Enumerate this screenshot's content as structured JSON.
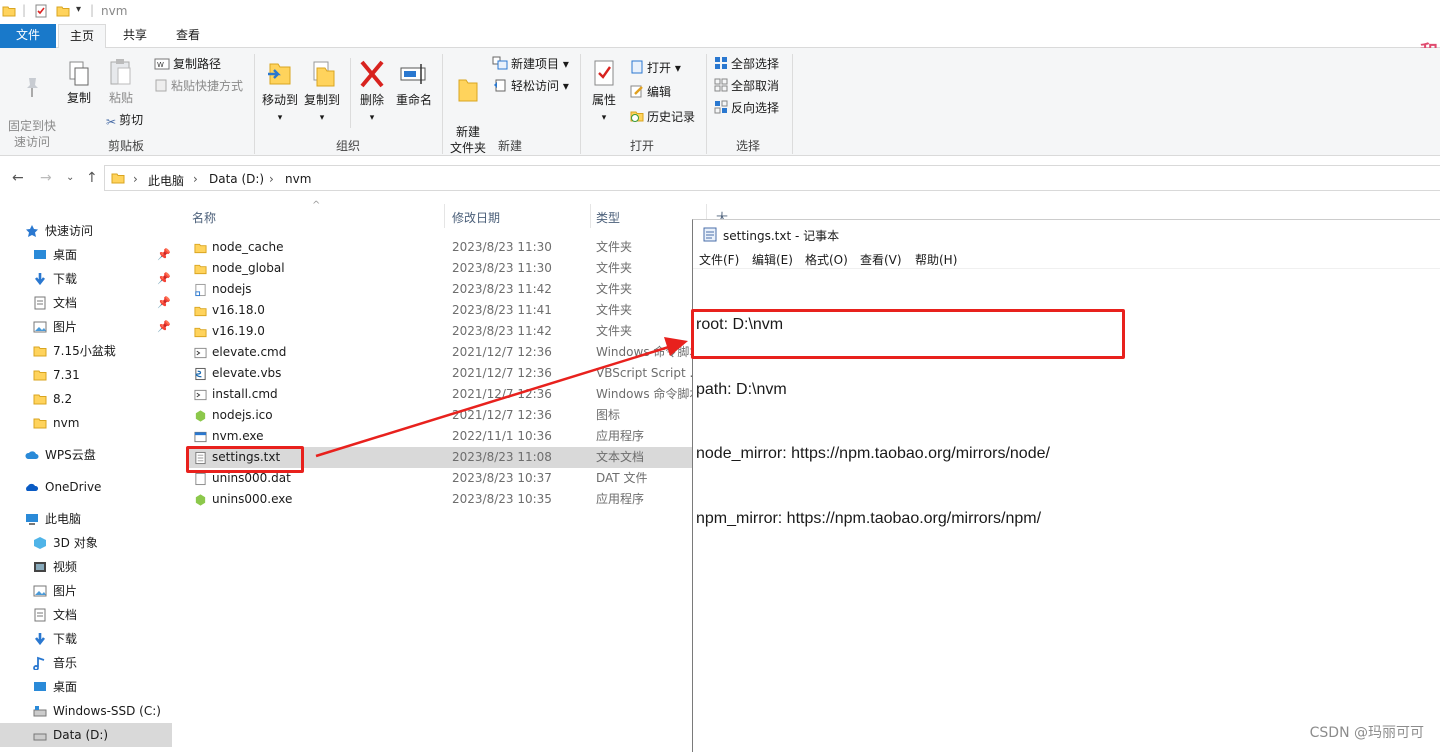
{
  "window": {
    "title": "nvm"
  },
  "tabs": [
    "文件",
    "主页",
    "共享",
    "查看"
  ],
  "ribbon": {
    "clipboard": {
      "pin": "固定到快\n速访问",
      "copy": "复制",
      "paste": "粘贴",
      "copy_path": "复制路径",
      "paste_shortcut": "粘贴快捷方式",
      "cut": "剪切",
      "label": "剪贴板"
    },
    "organize": {
      "move_to": "移动到",
      "copy_to": "复制到",
      "delete": "删除",
      "rename": "重命名",
      "label": "组织"
    },
    "new": {
      "new_folder": "新建\n文件夹",
      "new_item": "新建项目 ▾",
      "easy_access": "轻松访问 ▾",
      "label": "新建"
    },
    "open": {
      "properties": "属性",
      "open": "打开 ▾",
      "edit": "编辑",
      "history": "历史记录",
      "label": "打开"
    },
    "select": {
      "select_all": "全部选择",
      "select_none": "全部取消",
      "invert": "反向选择",
      "label": "选择"
    }
  },
  "address": {
    "crumbs": [
      "此电脑",
      "Data (D:)",
      "nvm"
    ]
  },
  "nav_pane": {
    "quick_access": "快速访问",
    "quick_items": [
      {
        "label": "桌面",
        "pinned": true
      },
      {
        "label": "下载",
        "pinned": true
      },
      {
        "label": "文档",
        "pinned": true
      },
      {
        "label": "图片",
        "pinned": true
      },
      {
        "label": "7.15小盆栽",
        "pinned": false
      },
      {
        "label": "7.31",
        "pinned": false
      },
      {
        "label": "8.2",
        "pinned": false
      },
      {
        "label": "nvm",
        "pinned": false
      }
    ],
    "wps": "WPS云盘",
    "onedrive": "OneDrive",
    "this_pc": "此电脑",
    "pc_items": [
      "3D 对象",
      "视频",
      "图片",
      "文档",
      "下载",
      "音乐",
      "桌面",
      "Windows-SSD (C:)",
      "Data (D:)"
    ]
  },
  "file_list": {
    "columns": {
      "name": "名称",
      "modified": "修改日期",
      "type": "类型",
      "size": "大小"
    },
    "files": [
      {
        "name": "node_cache",
        "modified": "2023/8/23 11:30",
        "type": "文件夹",
        "icon": "folder-icon"
      },
      {
        "name": "node_global",
        "modified": "2023/8/23 11:30",
        "type": "文件夹",
        "icon": "folder-icon"
      },
      {
        "name": "nodejs",
        "modified": "2023/8/23 11:42",
        "type": "文件夹",
        "icon": "shortcut-folder-icon"
      },
      {
        "name": "v16.18.0",
        "modified": "2023/8/23 11:41",
        "type": "文件夹",
        "icon": "folder-icon"
      },
      {
        "name": "v16.19.0",
        "modified": "2023/8/23 11:42",
        "type": "文件夹",
        "icon": "folder-icon"
      },
      {
        "name": "elevate.cmd",
        "modified": "2021/12/7 12:36",
        "type": "Windows 命令脚本",
        "icon": "cmd-icon"
      },
      {
        "name": "elevate.vbs",
        "modified": "2021/12/7 12:36",
        "type": "VBScript Script ...",
        "icon": "vbs-icon"
      },
      {
        "name": "install.cmd",
        "modified": "2021/12/7 12:36",
        "type": "Windows 命令脚本",
        "icon": "cmd-icon"
      },
      {
        "name": "nodejs.ico",
        "modified": "2021/12/7 12:36",
        "type": "图标",
        "icon": "node-icon"
      },
      {
        "name": "nvm.exe",
        "modified": "2022/11/1 10:36",
        "type": "应用程序",
        "icon": "exe-icon"
      },
      {
        "name": "settings.txt",
        "modified": "2023/8/23 11:08",
        "type": "文本文档",
        "icon": "txt-icon"
      },
      {
        "name": "unins000.dat",
        "modified": "2023/8/23 10:37",
        "type": "DAT 文件",
        "icon": "file-icon"
      },
      {
        "name": "unins000.exe",
        "modified": "2023/8/23 10:35",
        "type": "应用程序",
        "icon": "node-icon"
      }
    ]
  },
  "notepad": {
    "title": "settings.txt - 记事本",
    "menu": [
      "文件(F)",
      "编辑(E)",
      "格式(O)",
      "查看(V)",
      "帮助(H)"
    ],
    "lines": [
      "root: D:\\nvm",
      "path: D:\\nvm",
      "node_mirror: https://npm.taobao.org/mirrors/node/",
      "npm_mirror: https://npm.taobao.org/mirrors/npm/"
    ]
  },
  "corner_mark": "和",
  "watermark": "CSDN @玛丽可可",
  "colors": {
    "accent": "#1979ca",
    "annotation_red": "#e8211d",
    "folder": "#ffd35c",
    "selection": "#d9d9d9"
  }
}
